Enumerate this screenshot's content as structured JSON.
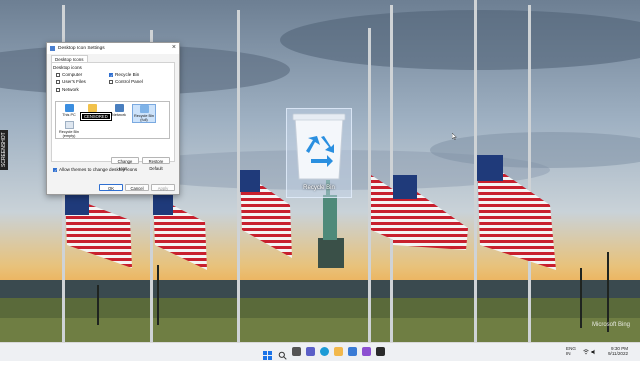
{
  "desktop": {
    "recycle_bin_label": "Recycle Bin",
    "side_tag": "SCREENSHOT",
    "watermark": "Microsoft Bing"
  },
  "dialog": {
    "title": "Desktop Icon Settings",
    "tab": "Desktop Icons",
    "group_label": "Desktop icons",
    "checkboxes": [
      {
        "label": "Computer",
        "checked": false
      },
      {
        "label": "Recycle Bin",
        "checked": true
      },
      {
        "label": "User's Files",
        "checked": false
      },
      {
        "label": "Control Panel",
        "checked": false
      },
      {
        "label": "Network",
        "checked": false
      }
    ],
    "icons": [
      {
        "label": "This PC",
        "icon": "monitor-icon"
      },
      {
        "label": "CENSORED",
        "icon": "folder-icon"
      },
      {
        "label": "Network",
        "icon": "network-icon"
      },
      {
        "label": "Recycle Bin (full)",
        "icon": "recycle-bin-full-icon"
      },
      {
        "label": "Recycle Bin (empty)",
        "icon": "recycle-bin-empty-icon"
      }
    ],
    "change_icon_label": "Change Icon...",
    "restore_default_label": "Restore Default",
    "allow_themes_label": "Allow themes to change desktop icons",
    "allow_themes_checked": true,
    "ok_label": "OK",
    "cancel_label": "Cancel",
    "apply_label": "Apply"
  },
  "taskbar": {
    "lang_line1": "ENG",
    "lang_line2": "IN",
    "time": "9:30 PM",
    "date": "9/11/2022",
    "pinned": [
      {
        "name": "windows-start-icon",
        "color": "#1a73e8"
      },
      {
        "name": "search-icon",
        "color": "#333333"
      },
      {
        "name": "task-view-icon",
        "color": "#444444"
      },
      {
        "name": "chat-icon",
        "color": "#5b5fc7"
      },
      {
        "name": "edge-icon",
        "color": "#1c9bd6"
      },
      {
        "name": "file-explorer-icon",
        "color": "#f2b84b"
      },
      {
        "name": "store-icon",
        "color": "#3a7bd5"
      },
      {
        "name": "media-icon",
        "color": "#8c4fd1"
      },
      {
        "name": "terminal-icon",
        "color": "#2b2b2b"
      },
      {
        "name": "settings-icon",
        "color": "#6b6b6b"
      }
    ]
  }
}
